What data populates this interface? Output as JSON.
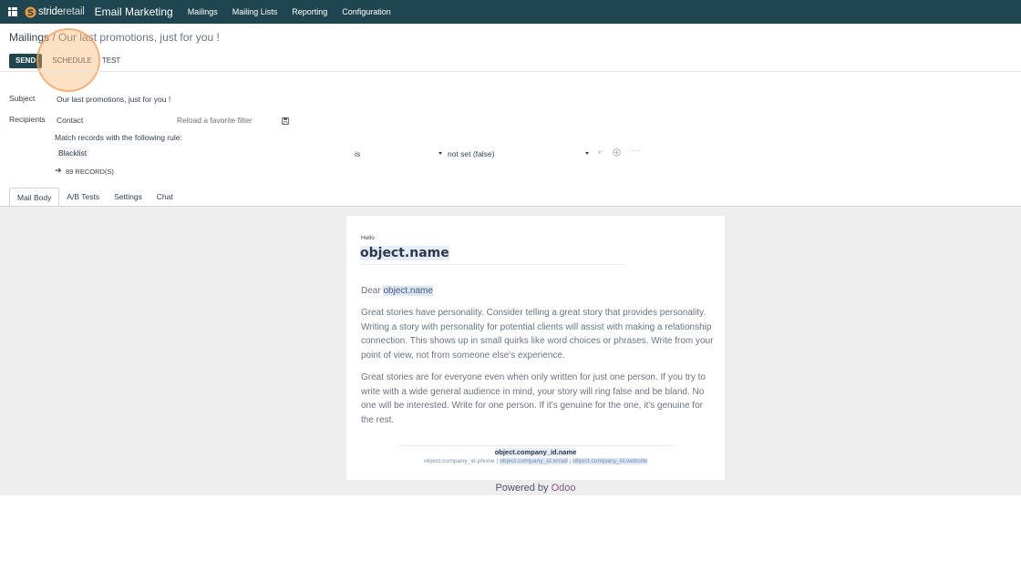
{
  "navbar": {
    "brand_part1": "stride",
    "brand_part2": "retail",
    "app_title": "Email Marketing",
    "menu": [
      "Mailings",
      "Mailing Lists",
      "Reporting",
      "Configuration"
    ]
  },
  "breadcrumb": {
    "parent": "Mailings",
    "separator": "/",
    "current": "Our last promotions, just for you !"
  },
  "actions": {
    "send": "SEND",
    "schedule": "SCHEDULE",
    "test": "TEST"
  },
  "form": {
    "subject_label": "Subject",
    "subject_value": "Our last promotions, just for you !",
    "recipients_label": "Recipients",
    "recipients_value": "Contact",
    "favorite_filter": "Reload a favorite filter",
    "match_rule": "Match records with the following rule:",
    "rule_field": "Blacklist",
    "rule_operator": "is",
    "rule_value": "not set (false)",
    "records": "89 RECORD(S)"
  },
  "tabs": [
    "Mail Body",
    "A/B Tests",
    "Settings",
    "Chat"
  ],
  "mail": {
    "hello": "Hello",
    "heading": "object.name",
    "dear": "Dear",
    "dear_name": "object.name",
    "paragraph1": "Great stories have personality. Consider telling a great story that provides personality. Writing a story with personality for potential clients will assist with making a relationship connection. This shows up in small quirks like word choices or phrases. Write from your point of view, not from someone else's experience.",
    "paragraph2": "Great stories are for everyone even when only written for just one person. If you try to write with a wide general audience in mind, your story will ring false and be bland. No one will be interested. Write for one person. If it's genuine for the one, it's genuine for the rest.",
    "company_name": "object.company_id.name",
    "company_phone": "object.company_id.phone",
    "company_email": "object.company_id.email",
    "company_website": "object.company_id.website",
    "contact_sep": "|"
  },
  "powered": {
    "prefix": "Powered by",
    "brand": "Odoo"
  },
  "colors": {
    "navbar": "#1f4650",
    "highlight": "#f5a05a"
  }
}
